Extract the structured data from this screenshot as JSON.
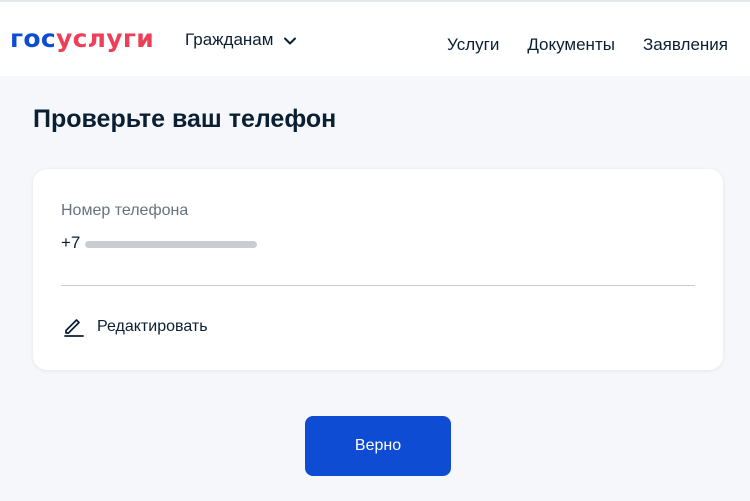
{
  "header": {
    "logo": {
      "part1": "гос",
      "part2": "услуги"
    },
    "audience_label": "Гражданам",
    "nav": [
      {
        "label": "Услуги"
      },
      {
        "label": "Документы"
      },
      {
        "label": "Заявления"
      }
    ]
  },
  "main": {
    "title": "Проверьте ваш телефон",
    "phone_card": {
      "label": "Номер телефона",
      "value_prefix": "+7",
      "edit_label": "Редактировать"
    },
    "confirm_button_label": "Верно"
  },
  "icons": {
    "chevron": "chevron-down-icon",
    "edit": "pencil-icon"
  },
  "colors": {
    "brand_blue": "#0d4cd3",
    "brand_red": "#ee3f58",
    "text": "#0b1f33",
    "muted": "#66727f",
    "background": "#f5f7fa"
  }
}
